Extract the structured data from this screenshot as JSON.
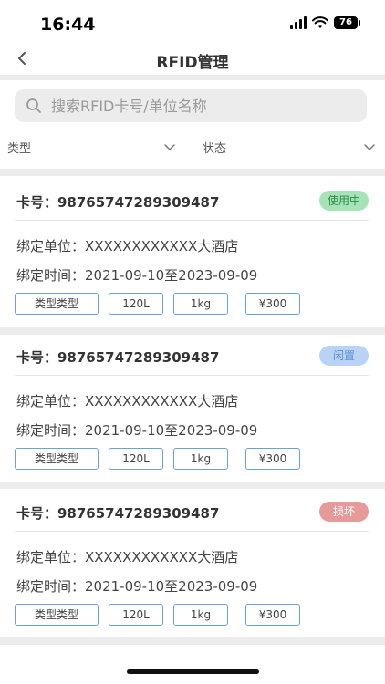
{
  "status_bar": {
    "time": "16:44",
    "battery": "76"
  },
  "nav": {
    "title": "RFID管理"
  },
  "search": {
    "placeholder": "搜索RFID卡号/单位名称"
  },
  "filters": {
    "type_label": "类型",
    "status_label": "状态"
  },
  "cards": [
    {
      "card_no": "卡号：98765747289309487",
      "status": "使用中",
      "unit": "绑定单位：XXXXXXXXXXXX大酒店",
      "time": "绑定时间：2021-09-10至2023-09-09",
      "tags": [
        "类型类型",
        "120L",
        "1kg",
        "¥300"
      ]
    },
    {
      "card_no": "卡号：98765747289309487",
      "status": "闲置",
      "unit": "绑定单位：XXXXXXXXXXXX大酒店",
      "time": "绑定时间：2021-09-10至2023-09-09",
      "tags": [
        "类型类型",
        "120L",
        "1kg",
        "¥300"
      ]
    },
    {
      "card_no": "卡号：98765747289309487",
      "status": "损坏",
      "unit": "绑定单位：XXXXXXXXXXXX大酒店",
      "time": "绑定时间：2021-09-10至2023-09-09",
      "tags": [
        "类型类型",
        "120L",
        "1kg",
        "¥300"
      ]
    }
  ],
  "colors": {
    "inuse": "#a6e3b6",
    "idle": "#b9d3f6",
    "broken": "#e79a9a",
    "tag_border": "#6aa0e0"
  }
}
